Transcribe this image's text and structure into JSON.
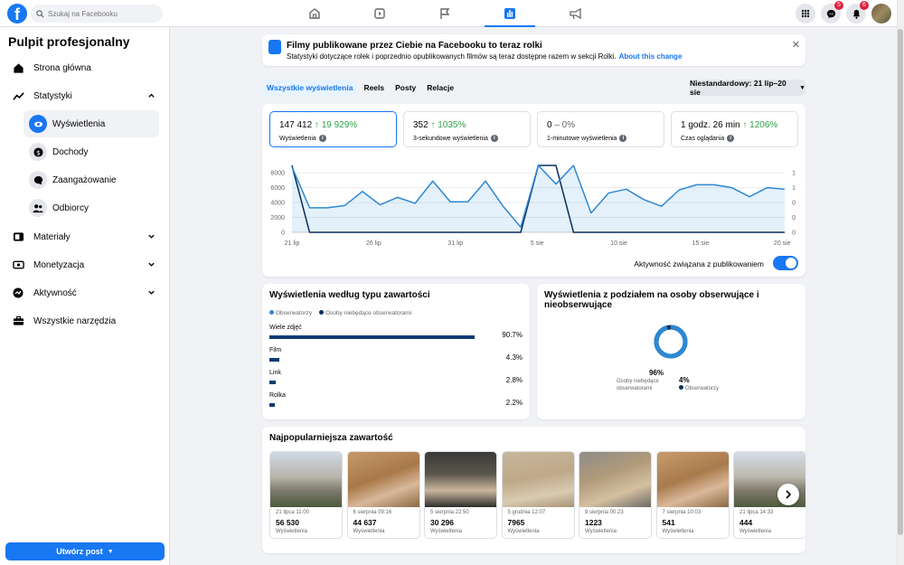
{
  "topbar": {
    "search_placeholder": "Szukaj na Facebooku",
    "messenger_badge": "5",
    "notifications_badge": "6"
  },
  "sidebar": {
    "title": "Pulpit profesjonalny",
    "items": [
      {
        "label": "Strona główna"
      },
      {
        "label": "Statystyki"
      },
      {
        "label": "Wyświetlenia"
      },
      {
        "label": "Dochody"
      },
      {
        "label": "Zaangażowanie"
      },
      {
        "label": "Odbiorcy"
      },
      {
        "label": "Materiały"
      },
      {
        "label": "Monetyzacja"
      },
      {
        "label": "Aktywność"
      },
      {
        "label": "Wszystkie narzędzia"
      }
    ],
    "create_post": "Utwórz post"
  },
  "banner": {
    "title": "Filmy publikowane przez Ciebie na Facebooku to teraz rolki",
    "text": "Statystyki dotyczące rolek i poprzednio opublikowanych filmów są teraz dostępne razem w sekcji Rolki.",
    "link": "About this change"
  },
  "tabs": [
    "Wszystkie wyświetlenia",
    "Reels",
    "Posty",
    "Relacje"
  ],
  "range": "Niestandardowy: 21 lip–20 sie",
  "metrics": [
    {
      "value": "147 412",
      "change": "↑ 19 929%",
      "label": "Wyświetlenia"
    },
    {
      "value": "352",
      "change": "↑ 1035%",
      "label": "3-sekundowe wyświetlenia"
    },
    {
      "value": "0",
      "change": "– 0%",
      "label": "1-minutowe wyświetlenia"
    },
    {
      "value": "1 godz. 26 min",
      "change": "↑ 1206%",
      "label": "Czas oglądania"
    }
  ],
  "chart_data": {
    "type": "line",
    "x_ticks": [
      "21 lip",
      "26 lip",
      "31 lip",
      "5 sie",
      "10 sie",
      "15 sie",
      "20 sie"
    ],
    "y_left_ticks": [
      "8000",
      "6000",
      "4000",
      "2000",
      "0"
    ],
    "y_left_range": [
      0,
      9000
    ],
    "y_right_ticks": [
      "1",
      "1",
      "0",
      "0",
      "0"
    ],
    "series": [
      {
        "color": "#2d88d4",
        "values": [
          8800,
          3300,
          3300,
          3600,
          5500,
          3700,
          4700,
          3900,
          6900,
          4100,
          4100,
          6900,
          3500,
          700,
          9000,
          6500,
          9000,
          2600,
          5300,
          5800,
          4400,
          3500,
          5700,
          6400,
          6400,
          6000,
          4800,
          6000,
          5800
        ]
      },
      {
        "color": "#0a2e5c",
        "values": [
          9000,
          0,
          0,
          0,
          0,
          0,
          0,
          0,
          0,
          0,
          0,
          0,
          0,
          0,
          9000,
          9000,
          0,
          0,
          0,
          0,
          0,
          0,
          0,
          0,
          0,
          0,
          0,
          0,
          0
        ]
      }
    ],
    "grid": true
  },
  "toggle_label": "Aktywność związana z publikowaniem",
  "type_card": {
    "title": "Wyświetlenia według typu zawartości",
    "legend": [
      "Obserwatorzy",
      "Osoby niebędące obserwatorami"
    ],
    "rows": [
      {
        "label": "Wiele zdjęć",
        "pct": "90.7%",
        "value": 90.7
      },
      {
        "label": "Film",
        "pct": "4.3%",
        "value": 4.3
      },
      {
        "label": "Link",
        "pct": "2.8%",
        "value": 2.8
      },
      {
        "label": "Rolka",
        "pct": "2.2%",
        "value": 2.2
      }
    ]
  },
  "follow_card": {
    "title": "Wyświetlenia z podziałem na osoby obserwujące i nieobserwujące",
    "non_followers_pct": "96%",
    "non_followers_label": "Osoby niebędące obserwatorami",
    "followers_pct": "4%",
    "followers_label": "Obserwatorzy",
    "non_followers_value": 96
  },
  "top_card": {
    "title": "Najpopularniejsza zawartość",
    "items": [
      {
        "date": "21 lipca 11:00",
        "value": "56 530",
        "label": "Wyświetlenia"
      },
      {
        "date": "6 sierpnia 09:16",
        "value": "44 637",
        "label": "Wyświetlenia"
      },
      {
        "date": "5 sierpnia 22:50",
        "value": "30 296",
        "label": "Wyświetlenia"
      },
      {
        "date": "5 grudnia 12:07",
        "value": "7965",
        "label": "Wyświetlenia"
      },
      {
        "date": "9 sierpnia 00:23",
        "value": "1223",
        "label": "Wyświetlenia"
      },
      {
        "date": "7 sierpnia 10:03",
        "value": "541",
        "label": "Wyświetlenia"
      },
      {
        "date": "21 lipca 14:33",
        "value": "444",
        "label": "Wyświetlenia"
      }
    ]
  },
  "colors": {
    "accent": "#1877f2",
    "positive": "#31a24c",
    "bar_dark": "#0a3a75"
  }
}
